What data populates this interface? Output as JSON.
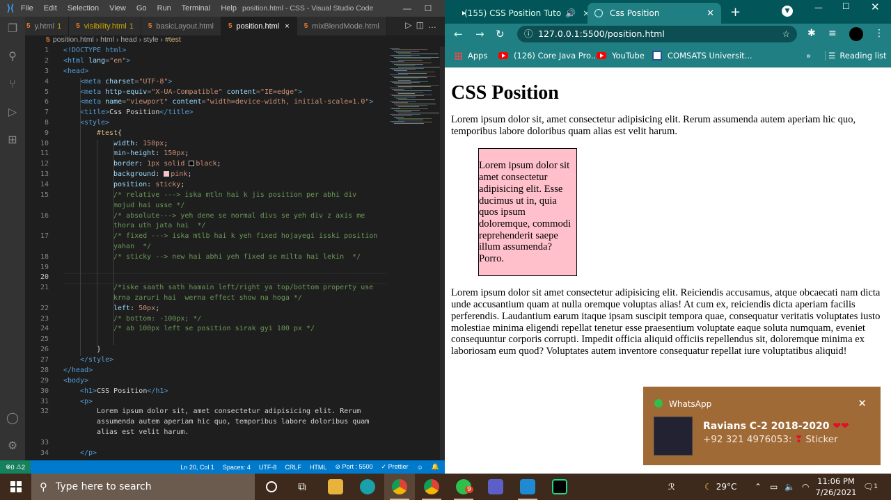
{
  "vscode": {
    "menu": [
      "File",
      "Edit",
      "Selection",
      "View",
      "Go",
      "Run",
      "Terminal",
      "Help"
    ],
    "window_title": "position.html - CSS - Visual Studio Code",
    "tabs": [
      {
        "label": "y.html",
        "mod": "1"
      },
      {
        "label": "visibility.html",
        "mod": "1"
      },
      {
        "label": "basicLayout.html",
        "mod": ""
      },
      {
        "label": "position.html",
        "mod": ""
      },
      {
        "label": "mixBlendMode.html",
        "mod": ""
      }
    ],
    "breadcrumb": [
      "position.html",
      "html",
      "head",
      "style",
      "#test"
    ],
    "line_numbers": [
      "1",
      "2",
      "3",
      "4",
      "5",
      "6",
      "7",
      "8",
      "9",
      "10",
      "11",
      "12",
      "13",
      "14",
      "15",
      "",
      "16",
      "",
      "17",
      "",
      "18",
      "19",
      "20",
      "21",
      "",
      "22",
      "23",
      "24",
      "25",
      "26",
      "27",
      "28",
      "29",
      "30",
      "31",
      "32",
      "",
      "",
      "33",
      "34"
    ],
    "code": {
      "l1": "<!DOCTYPE html>",
      "l2a": "<html ",
      "l2b": "lang",
      "l2c": "=",
      "l2d": "\"en\"",
      "l2e": ">",
      "l3": "<head>",
      "l4a": "<meta ",
      "l4b": "charset",
      "l4c": "=",
      "l4d": "\"UTF-8\"",
      "l4e": ">",
      "l5a": "<meta ",
      "l5b": "http-equiv",
      "l5c": "=",
      "l5d": "\"X-UA-Compatible\"",
      "l5e": " content",
      "l5f": "=",
      "l5g": "\"IE=edge\"",
      "l5h": ">",
      "l6a": "<meta ",
      "l6b": "name",
      "l6c": "=",
      "l6d": "\"viewport\"",
      "l6e": " content",
      "l6f": "=",
      "l6g": "\"width=device-width, initial-scale=1.0\"",
      "l6h": ">",
      "l7a": "<title>",
      "l7b": "Css Position",
      "l7c": "</title>",
      "l8": "<style>",
      "l9a": "#test",
      "l9b": "{",
      "l10a": "width",
      ": ": "",
      "l10b": "150px",
      "l11a": "min-height",
      "l11b": "150px",
      "l12a": "border",
      "l12b": "1px solid ",
      "l12c": "black",
      "l13a": "background",
      "l13b": "pink",
      "l14a": "position",
      "l14b": "sticky",
      "l15": "/* relative ---> iska mtln hai k jis position per abhi div",
      "l15w": "mojud hai usse */",
      "l16": "/* absolute---> yeh dene se normal divs se yeh div z axis me",
      "l16w": "thora uth jata hai  */",
      "l17": "/* fixed ---> iska mtlb hai k yeh fixed hojayegi isski position",
      "l17w": "yahan  */",
      "l18": "/* sticky --> new hai abhi yeh fixed se milta hai lekin  */",
      "l21": "/*iske saath sath hamain left/right ya top/bottom property use",
      "l21w": "krna zaruri hai  werna effect show na hoga */",
      "l22a": "left",
      "l22b": "50px",
      "l23": "/* bottom: -100px; */",
      "l24": "/* ab 100px left se position sirak gyi 100 px */",
      "l26": "}",
      "l27": "</style>",
      "l28": "</head>",
      "l29": "<body>",
      "l30a": "<h1>",
      "l30b": "CSS Position",
      "l30c": "</h1>",
      "l31": "<p>",
      "l32": "Lorem ipsum dolor sit, amet consectetur adipisicing elit. Rerum",
      "l32w": "assumenda autem aperiam hic quo, temporibus labore doloribus quam",
      "l32x": "alias est velit harum.",
      "l34": "</p>"
    },
    "status": {
      "errors": "0",
      "warnings": "2",
      "position": "Ln 20, Col 1",
      "spaces": "Spaces: 4",
      "encoding": "UTF-8",
      "eol": "CRLF",
      "lang": "HTML",
      "port": "Port : 5500",
      "prettier": "Prettier"
    }
  },
  "chrome": {
    "tabs": [
      {
        "label": "(155) CSS Position Tuto"
      },
      {
        "label": "Css Position"
      }
    ],
    "url": "127.0.0.1:5500/position.html",
    "bookmarks": [
      "Apps",
      "(126) Core Java Pro...",
      "YouTube",
      "COMSATS Universit..."
    ],
    "reading_list": "Reading list",
    "page": {
      "h1": "CSS Position",
      "p1": "Lorem ipsum dolor sit, amet consectetur adipisicing elit. Rerum assumenda autem aperiam hic quo, temporibus labore doloribus quam alias est velit harum.",
      "box": "Lorem ipsum dolor sit amet consectetur adipisicing elit. Esse ducimus ut in, quia quos ipsum doloremque, commodi reprehenderit saepe illum assumenda? Porro.",
      "p2": "Lorem ipsum dolor sit amet consectetur adipisicing elit. Reiciendis accusamus, atque obcaecati nam dicta unde accusantium quam at nulla oremque voluptas alias! At cum ex, reiciendis dicta aperiam facilis perferendis. Laudantium earum itaque ipsam suscipit tempora quae, consequatur veritatis voluptates iusto molestiae minima eligendi repellat tenetur esse praesentium voluptate eaque soluta numquam, eveniet consequuntur corporis corrupti. Impedit officia aliquid officiis repellendus sit, doloremque minima ex laboriosam eum quod? Voluptates autem inventore consequatur repellat iure voluptatibus aliquid!"
    }
  },
  "toast": {
    "app": "WhatsApp",
    "title": "Ravians C-2 2018-2020",
    "message": "+92 321 4976053:",
    "sticker": "Sticker"
  },
  "taskbar": {
    "search_placeholder": "Type here to search",
    "temperature": "29°C",
    "time": "11:06 PM",
    "date": "7/26/2021",
    "whatsapp_badge": "9",
    "notif_count": "1"
  }
}
